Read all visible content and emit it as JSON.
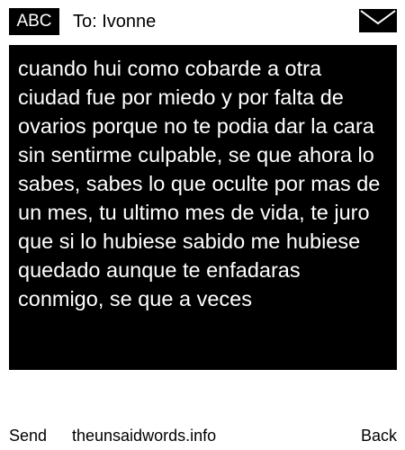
{
  "header": {
    "input_mode": "ABC",
    "recipient": "To: Ivonne",
    "message_icon": "envelope-icon"
  },
  "message": {
    "text": "cuando hui como cobarde a otra ciudad fue por miedo y por falta de ovarios porque no te podia dar la cara sin sentirme culpable, se que ahora lo sabes, sabes lo que oculte por mas de un mes, tu ultimo mes de vida, te juro que si lo hubiese sabido me hubiese quedado aunque te enfadaras conmigo, se que a veces"
  },
  "softkeys": {
    "left": "Send",
    "center": "theunsaidwords.info",
    "right": "Back"
  },
  "colors": {
    "background": "#ffffff",
    "message_background": "#000000",
    "message_text": "#ffffff",
    "text": "#000000"
  }
}
